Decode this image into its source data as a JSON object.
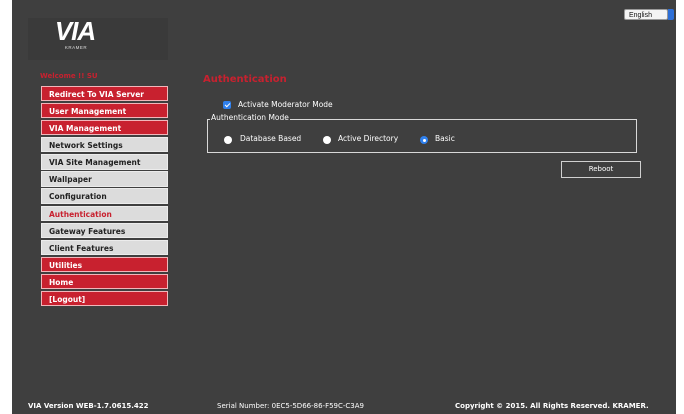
{
  "language": {
    "selected": "English"
  },
  "logo": {
    "text": "VIA",
    "subtext": "KRAMER"
  },
  "welcome": "Welcome !! SU",
  "nav": [
    {
      "label": "Redirect To VIA Server",
      "style": "red"
    },
    {
      "label": "User Management",
      "style": "red"
    },
    {
      "label": "VIA Management",
      "style": "red"
    },
    {
      "label": "Network Settings",
      "style": "grey"
    },
    {
      "label": "VIA Site Management",
      "style": "grey"
    },
    {
      "label": "Wallpaper",
      "style": "grey"
    },
    {
      "label": "Configuration",
      "style": "grey"
    },
    {
      "label": "Authentication",
      "style": "grey",
      "active": true
    },
    {
      "label": "Gateway Features",
      "style": "grey"
    },
    {
      "label": "Client Features",
      "style": "grey"
    },
    {
      "label": "Utilities",
      "style": "red"
    },
    {
      "label": "Home",
      "style": "red"
    },
    {
      "label": "[Logout]",
      "style": "red"
    }
  ],
  "main": {
    "title": "Authentication",
    "moderator": {
      "label": "Activate Moderator Mode",
      "checked": true
    },
    "auth_mode": {
      "legend": "Authentication Mode",
      "options": [
        {
          "label": "Database Based",
          "selected": false
        },
        {
          "label": "Active Directory",
          "selected": false
        },
        {
          "label": "Basic",
          "selected": true
        }
      ]
    },
    "reboot_label": "Reboot"
  },
  "footer": {
    "version": "VIA Version WEB-1.7.0615.422",
    "serial": "Serial Number: 0EC5-5D66-86-F59C-C3A9",
    "copyright": "Copyright © 2015. All Rights Reserved. KRAMER."
  },
  "colors": {
    "accent": "#c8212f",
    "background": "#3f3f3f",
    "selection": "#2f80ed"
  }
}
